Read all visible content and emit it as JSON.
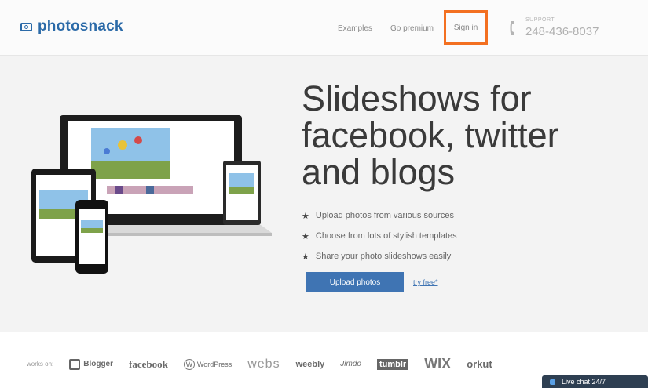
{
  "header": {
    "brand": "photosnack",
    "nav": [
      "Examples",
      "Go premium",
      "Sign in"
    ],
    "support_label": "SUPPORT",
    "support_phone": "248-436-8037"
  },
  "hero": {
    "headline": [
      "Slideshows for",
      "facebook, twitter",
      "and blogs"
    ],
    "features": [
      "Upload photos from various sources",
      "Choose from lots of stylish templates",
      "Share your photo slideshows easily"
    ],
    "upload_button": "Upload photos",
    "try_link": "try free*"
  },
  "partners": {
    "label": "works on:",
    "items": [
      "Blogger",
      "facebook",
      "WordPress",
      "webs",
      "weebly",
      "Jimdo",
      "tumblr",
      "WIX",
      "orkut"
    ]
  },
  "chat": {
    "label": "Live chat 24/7"
  },
  "colors": {
    "brand": "#2b6aa8",
    "highlight": "#f37021",
    "button": "#3f74b3"
  },
  "icons": [
    "photosnack-logo-icon",
    "phone-icon",
    "star-icon",
    "chat-icon"
  ]
}
